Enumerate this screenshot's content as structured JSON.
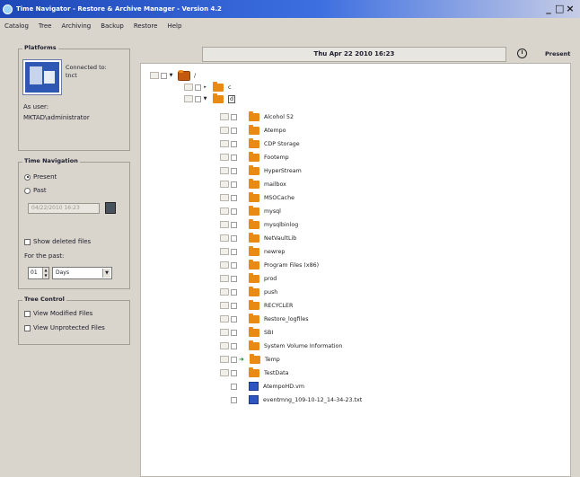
{
  "window": {
    "title": "Time Navigator - Restore & Archive Manager - Version 4.2"
  },
  "menu": {
    "items": [
      "Catalog",
      "Tree",
      "Archiving",
      "Backup",
      "Restore",
      "Help"
    ]
  },
  "platforms": {
    "title": "Platforms",
    "connected_label": "Connected to:",
    "connected_value": "tnct",
    "as_user_label": "As user:",
    "as_user_value": "MKTAD\\administrator"
  },
  "time_navigation": {
    "title": "Time Navigation",
    "present_label": "Present",
    "past_label": "Past",
    "past_date": "04/22/2010 16:23",
    "show_deleted_label": "Show deleted files",
    "for_the_past_label": "For the past:",
    "past_count": "01",
    "past_unit": "Days"
  },
  "tree_control": {
    "title": "Tree Control",
    "view_modified": "View Modified Files",
    "view_unprotected": "View Unprotected Files"
  },
  "timebar": {
    "current_time": "Thu Apr 22 2010 16:23",
    "present_label": "Present"
  },
  "tree": {
    "root": "/",
    "level1": "c",
    "level2": "d",
    "folders": [
      "Alcohol 52",
      "Atempo",
      "CDP Storage",
      "Footemp",
      "HyperStream",
      "mailbox",
      "MSOCache",
      "mysql",
      "mysqlbinlog",
      "NetVaultLib",
      "newrep",
      "Program Files (x86)",
      "prod",
      "push",
      "RECYCLER",
      "Restore_logfiles",
      "SBI",
      "System Volume Information",
      "Temp",
      "TestData"
    ],
    "files": [
      "AtempoHD.vm",
      "eventmng_109-10-12_14-34-23.txt"
    ]
  }
}
